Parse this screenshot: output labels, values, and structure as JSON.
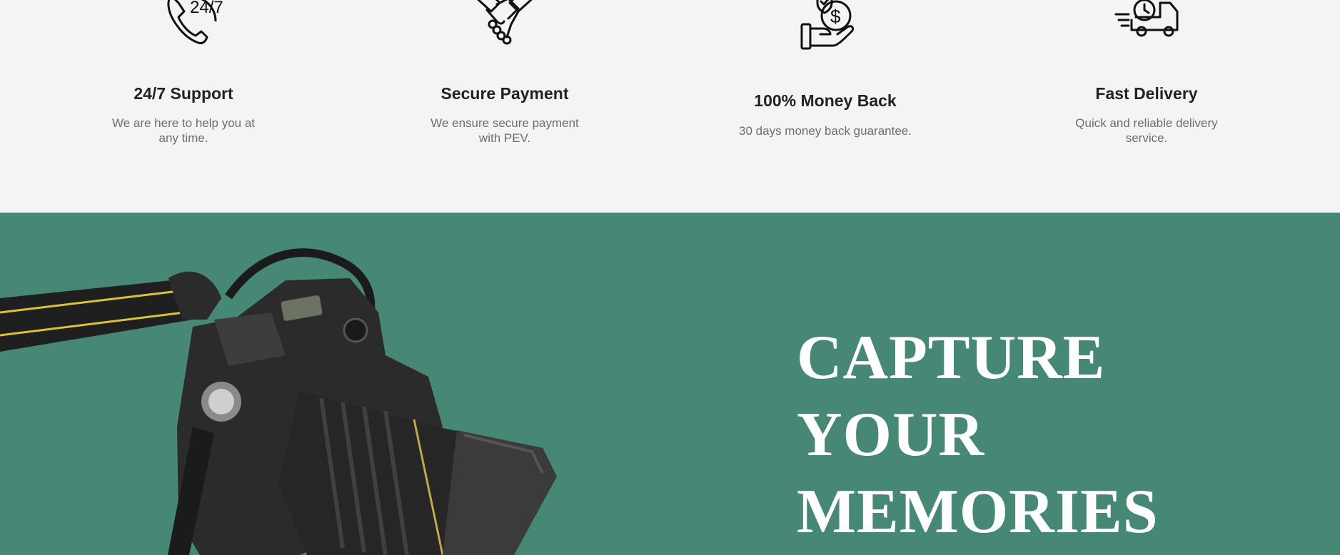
{
  "features": [
    {
      "title": "24/7 Support",
      "description": "We are here to help you at any time.",
      "icon": "phone-24-7-icon"
    },
    {
      "title": "Secure Payment",
      "description": "We ensure secure payment with PEV.",
      "icon": "handshake-icon"
    },
    {
      "title": "100% Money Back",
      "description": "30 days money back guarantee.",
      "icon": "money-back-hand-icon"
    },
    {
      "title": "Fast Delivery",
      "description": "Quick and reliable delivery service.",
      "icon": "delivery-truck-icon"
    }
  ],
  "icon_text": {
    "support": "24/7"
  },
  "hero": {
    "title_lines": [
      "CAPTURE",
      "YOUR",
      "MEMORIES"
    ],
    "image": "dslr-camera-with-strap",
    "background_color": "#468776"
  }
}
